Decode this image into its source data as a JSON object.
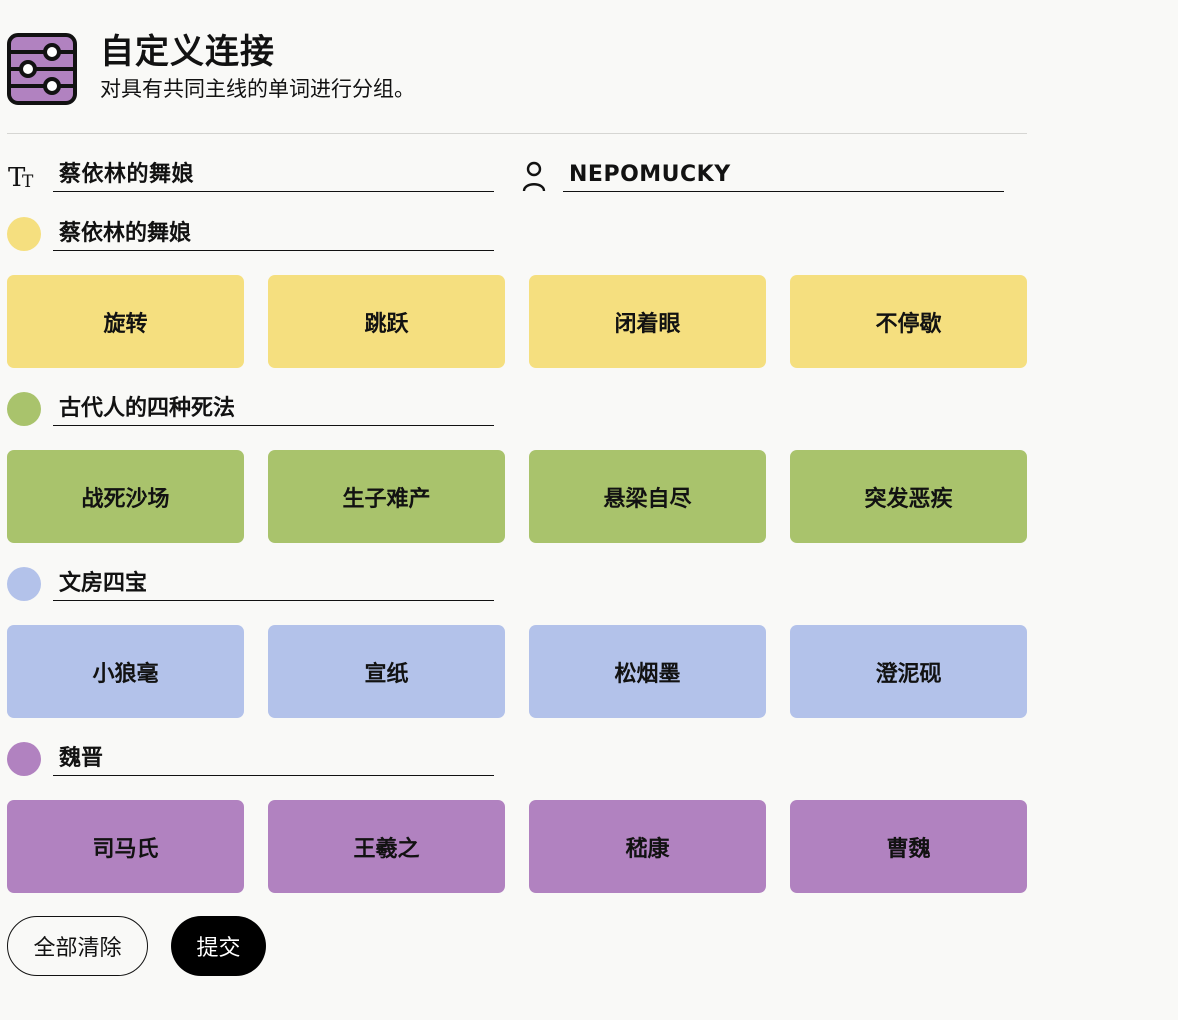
{
  "header": {
    "title": "自定义连接",
    "subtitle": "对具有共同主线的单词进行分组。",
    "icon": "sliders-icon"
  },
  "meta": {
    "puzzle_title": "蔡依林的舞娘",
    "author": "NEPOMUCKY",
    "title_icon": "text-size-icon",
    "author_icon": "person-icon"
  },
  "groups": [
    {
      "name": "蔡依林的舞娘",
      "color": "#f5df7f",
      "words": [
        "旋转",
        "跳跃",
        "闭着眼",
        "不停歇"
      ]
    },
    {
      "name": "古代人的四种死法",
      "color": "#a9c36c",
      "words": [
        "战死沙场",
        "生子难产",
        "悬梁自尽",
        "突发恶疾"
      ]
    },
    {
      "name": "文房四宝",
      "color": "#b3c2ea",
      "words": [
        "小狼毫",
        "宣纸",
        "松烟墨",
        "澄泥砚"
      ]
    },
    {
      "name": "魏晋",
      "color": "#b182c0",
      "words": [
        "司马氏",
        "王羲之",
        "嵇康",
        "曹魏"
      ]
    }
  ],
  "actions": {
    "clear_label": "全部清除",
    "submit_label": "提交"
  }
}
